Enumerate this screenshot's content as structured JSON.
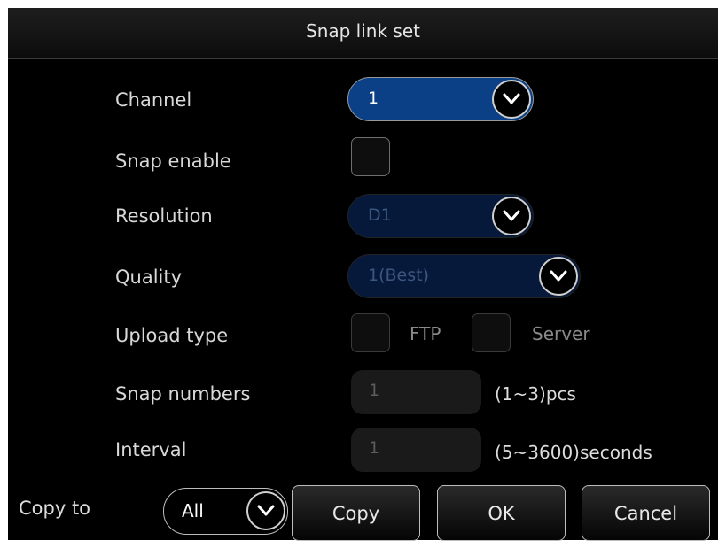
{
  "dialog": {
    "title": "Snap link set"
  },
  "fields": {
    "channel": {
      "label": "Channel",
      "value": "1"
    },
    "snap_enable": {
      "label": "Snap enable",
      "checked": false
    },
    "resolution": {
      "label": "Resolution",
      "value": "D1",
      "disabled": true
    },
    "quality": {
      "label": "Quality",
      "value": "1(Best)",
      "disabled": true
    },
    "upload_type": {
      "label": "Upload type",
      "ftp_label": "FTP",
      "server_label": "Server",
      "ftp_checked": false,
      "server_checked": false
    },
    "snap_numbers": {
      "label": "Snap numbers",
      "value": "1",
      "range": "(1~3)pcs"
    },
    "interval": {
      "label": "Interval",
      "value": "1",
      "range": "(5~3600)seconds"
    }
  },
  "footer": {
    "copy_to_label": "Copy to",
    "copy_to_value": "All",
    "copy_button": "Copy",
    "ok_button": "OK",
    "cancel_button": "Cancel"
  },
  "colors": {
    "accent": "#0b3f86",
    "accent_disabled": "#06193a",
    "background": "#000000"
  }
}
